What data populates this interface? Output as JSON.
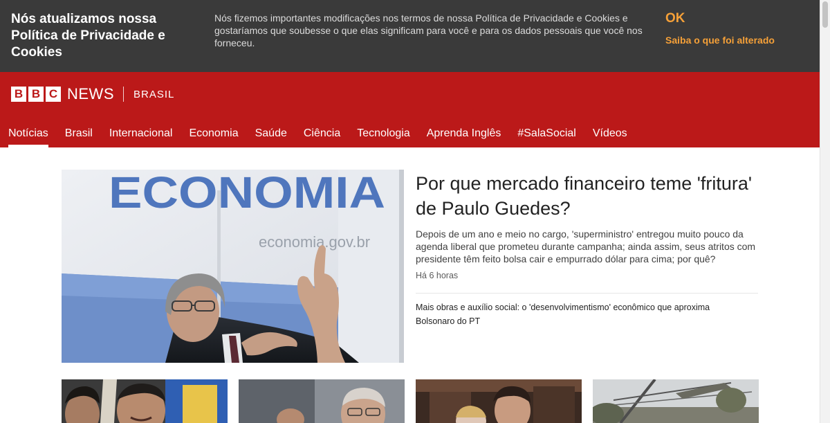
{
  "cookie_banner": {
    "title": "Nós atualizamos nossa Política de Privacidade e Cookies",
    "text": "Nós fizemos importantes modificações nos termos de nossa Política de Privacidade e Cookies e gostaríamos que soubesse o que elas significam para você e para os dados pessoais que você nos forneceu.",
    "ok_label": "OK",
    "link_label": "Saiba o que foi alterado",
    "accent_color": "#f5a038"
  },
  "masthead": {
    "logo_letters": [
      "B",
      "B",
      "C"
    ],
    "news_label": "NEWS",
    "edition_label": "BRASIL",
    "brand_color": "#bb1919"
  },
  "nav": {
    "items": [
      {
        "label": "Notícias",
        "active": true
      },
      {
        "label": "Brasil"
      },
      {
        "label": "Internacional"
      },
      {
        "label": "Economia"
      },
      {
        "label": "Saúde"
      },
      {
        "label": "Ciência"
      },
      {
        "label": "Tecnologia"
      },
      {
        "label": "Aprenda Inglês"
      },
      {
        "label": "#SalaSocial"
      },
      {
        "label": "Vídeos"
      }
    ]
  },
  "hero": {
    "image_text": "ECONOMIA",
    "image_subtext": "economia.gov.br",
    "headline": "Por que mercado financeiro teme 'fritura' de Paulo Guedes?",
    "summary": "Depois de um ano e meio no cargo, 'superministro' entregou muito pouco da agenda liberal que prometeu durante campanha; ainda assim, seus atritos com presidente têm feito bolsa cair e empurrado dólar para cima; por quê?",
    "timestamp": "Há 6 horas",
    "related": "Mais obras e auxílio social: o 'desenvolvimentismo' econômico que aproxima Bolsonaro do PT"
  }
}
